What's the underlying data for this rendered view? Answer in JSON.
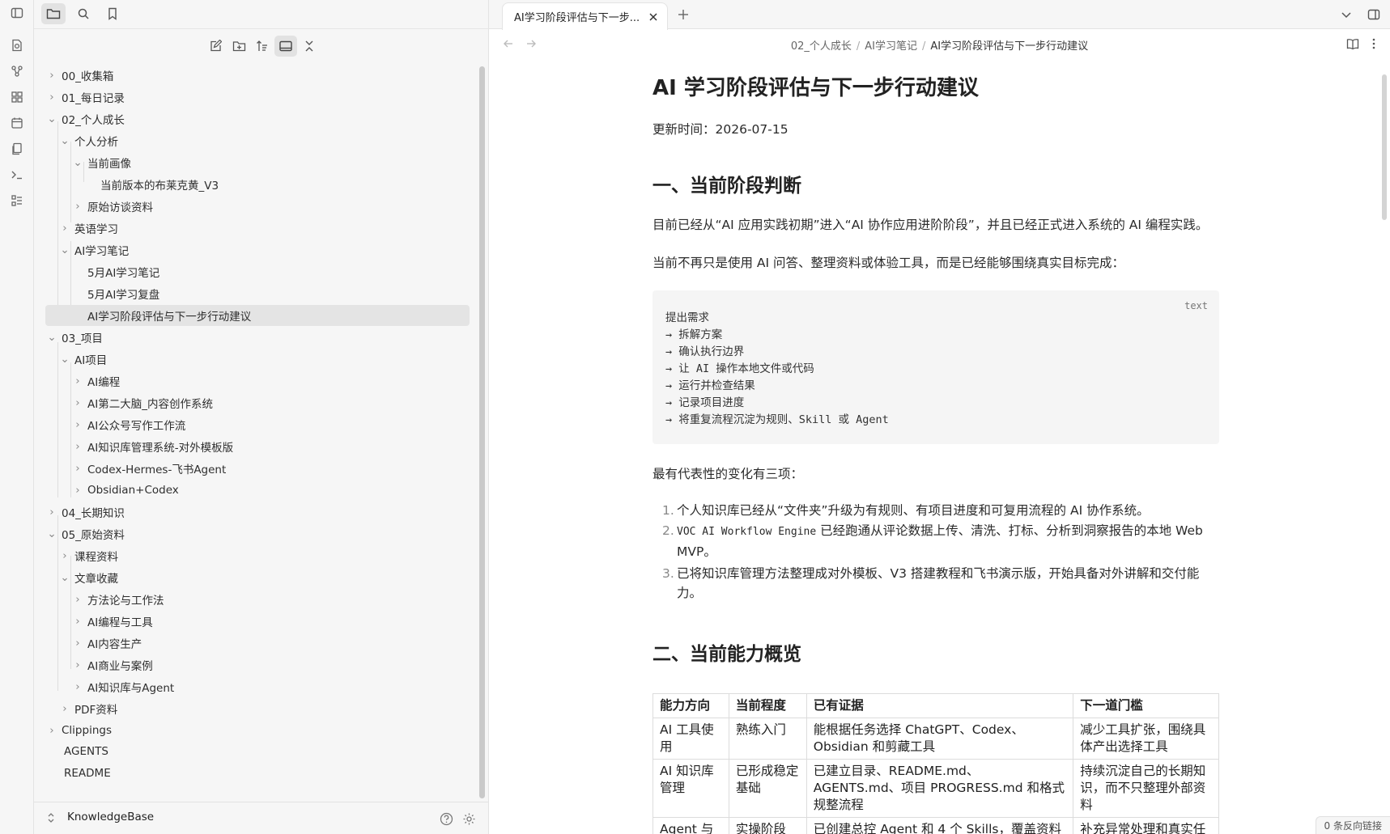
{
  "sidebar": {
    "vault_name": "KnowledgeBase",
    "tree": [
      {
        "label": "00_收集箱"
      },
      {
        "label": "01_每日记录"
      },
      {
        "label": "02_个人成长"
      },
      {
        "label": "个人分析"
      },
      {
        "label": "当前画像"
      },
      {
        "label": "当前版本的布莱克黄_V3"
      },
      {
        "label": "原始访谈资料"
      },
      {
        "label": "英语学习"
      },
      {
        "label": "AI学习笔记"
      },
      {
        "label": "5月AI学习笔记"
      },
      {
        "label": "5月AI学习复盘"
      },
      {
        "label": "AI学习阶段评估与下一步行动建议"
      },
      {
        "label": "03_项目"
      },
      {
        "label": "AI项目"
      },
      {
        "label": "AI编程"
      },
      {
        "label": "AI第二大脑_内容创作系统"
      },
      {
        "label": "AI公众号写作工作流"
      },
      {
        "label": "AI知识库管理系统-对外模板版"
      },
      {
        "label": "Codex-Hermes-飞书Agent"
      },
      {
        "label": "Obsidian+Codex"
      },
      {
        "label": "04_长期知识"
      },
      {
        "label": "05_原始资料"
      },
      {
        "label": "课程资料"
      },
      {
        "label": "文章收藏"
      },
      {
        "label": "方法论与工作法"
      },
      {
        "label": "AI编程与工具"
      },
      {
        "label": "AI内容生产"
      },
      {
        "label": "AI商业与案例"
      },
      {
        "label": "AI知识库与Agent"
      },
      {
        "label": "PDF资料"
      },
      {
        "label": "Clippings"
      },
      {
        "label": "AGENTS"
      },
      {
        "label": "README"
      }
    ]
  },
  "tab": {
    "label": "AI学习阶段评估与下一步..."
  },
  "breadcrumb": {
    "part1": "02_个人成长",
    "part2": "AI学习笔记",
    "current": "AI学习阶段评估与下一步行动建议",
    "sep": "/"
  },
  "doc": {
    "title": "AI 学习阶段评估与下一步行动建议",
    "updated": "更新时间：2026-07-15",
    "h2_1": "一、当前阶段判断",
    "p1": "目前已经从“AI 应用实践初期”进入“AI 协作应用进阶阶段”，并且已经正式进入系统的 AI 编程实践。",
    "p2": "当前不再只是使用 AI 问答、整理资料或体验工具，而是已经能够围绕真实目标完成：",
    "code_lang": "text",
    "code_lines": [
      "提出需求",
      "→ 拆解方案",
      "→ 确认执行边界",
      "→ 让 AI 操作本地文件或代码",
      "→ 运行并检查结果",
      "→ 记录项目进度",
      "→ 将重复流程沉淀为规则、Skill 或 Agent"
    ],
    "p3": "最有代表性的变化有三项：",
    "list": [
      {
        "num": "1.",
        "text": "个人知识库已经从“文件夹”升级为有规则、有项目进度和可复用流程的 AI 协作系统。"
      },
      {
        "num": "2.",
        "code": "VOC AI Workflow Engine",
        "text": " 已经跑通从评论数据上传、清洗、打标、分析到洞察报告的本地 Web MVP。"
      },
      {
        "num": "3.",
        "text": "已将知识库管理方法整理成对外模板、V3 搭建教程和飞书演示版，开始具备对外讲解和交付能力。"
      }
    ],
    "h2_2": "二、当前能力概览",
    "table": {
      "headers": [
        "能力方向",
        "当前程度",
        "已有证据",
        "下一道门槛"
      ],
      "rows": [
        [
          "AI 工具使用",
          "熟练入门",
          "能根据任务选择 ChatGPT、Codex、Obsidian 和剪藏工具",
          "减少工具扩张，围绕具体产出选择工具"
        ],
        [
          "AI 知识库管理",
          "已形成稳定基础",
          "已建立目录、README.md、AGENTS.md、项目 PROGRESS.md 和格式规整流程",
          "持续沉淀自己的长期知识，而不只整理外部资料"
        ],
        [
          "Agent 与",
          "实操阶段",
          "已创建总控 Agent 和 4 个 Skills，覆盖资料",
          "补充异常处理和真实任"
        ]
      ]
    }
  },
  "status": {
    "backlinks": "0 条反向链接"
  },
  "colors": {
    "sidebar_bg": "#f6f6f6",
    "selected_bg": "#e4e4e4",
    "code_bg": "#f5f5f5"
  }
}
